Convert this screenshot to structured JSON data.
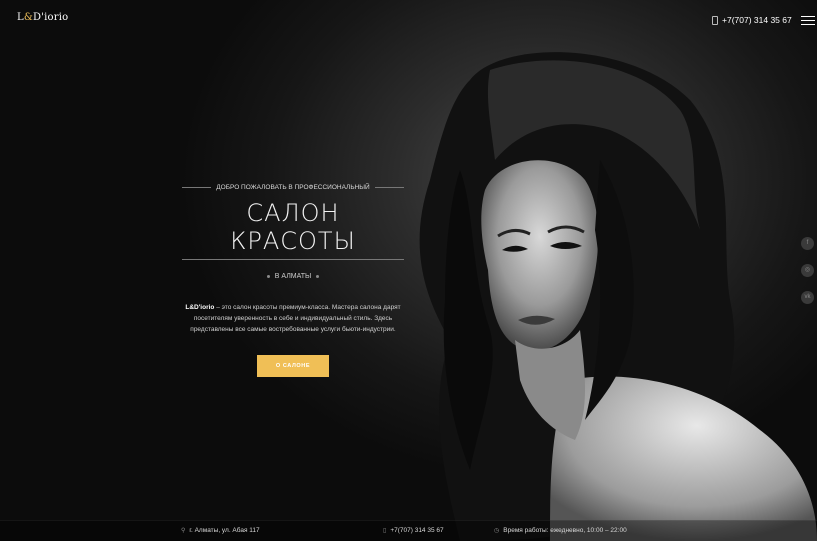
{
  "header": {
    "logo_prefix": "L",
    "logo_amp": "&",
    "logo_rest": "D'iorio",
    "phone": "+7(707) 314 35 67",
    "menu_icon": "hamburger-menu-icon"
  },
  "hero": {
    "welcome": "ДОБРО ПОЖАЛОВАТЬ В ПРОФЕССИОНАЛЬНЫЙ",
    "title": "САЛОН КРАСОТЫ",
    "city": "В АЛМАТЫ",
    "desc_brand": "L&D'iorio",
    "desc_text": " – это салон красоты премиум-класса. Мастера салона дарят посетителям уверенность в себе и индивидуальный стиль. Здесь представлены все самые востребованные услуги бьюти-индустрии.",
    "cta_label": "О САЛОНЕ"
  },
  "social": {
    "items": [
      {
        "icon": "facebook-icon",
        "glyph": "f"
      },
      {
        "icon": "instagram-icon",
        "glyph": "◎"
      },
      {
        "icon": "vk-icon",
        "glyph": "vk"
      }
    ]
  },
  "footer": {
    "address": "г. Алматы, ул. Абая 117",
    "phone": "+7(707) 314 35 67",
    "hours": "Время работы: ежедневно, 10:00 – 22:00"
  },
  "colors": {
    "accent": "#f0bf56",
    "background": "#0c0c0c"
  }
}
